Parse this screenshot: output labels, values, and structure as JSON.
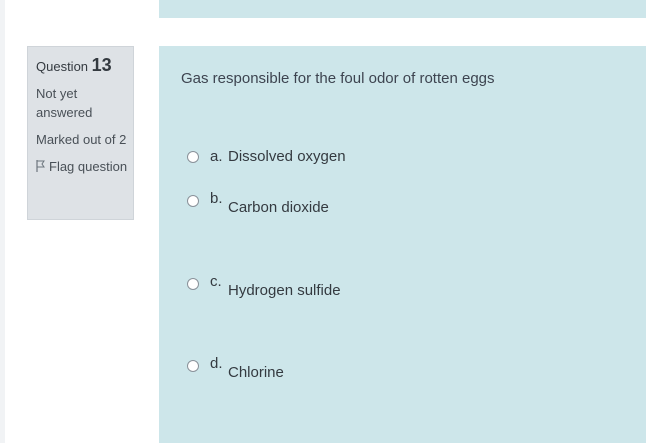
{
  "question_info": {
    "label": "Question",
    "number": "13",
    "state": "Not yet answered",
    "grade": "Marked out of 2",
    "flag_label": "Flag question"
  },
  "question": {
    "text": "Gas responsible for the foul odor of rotten eggs",
    "options": [
      {
        "letter": "a.",
        "text": "Dissolved oxygen",
        "selected": false
      },
      {
        "letter": "b.",
        "text": "Carbon dioxide",
        "selected": false
      },
      {
        "letter": "c.",
        "text": "Hydrogen sulfide",
        "selected": false
      },
      {
        "letter": "d.",
        "text": "Chlorine",
        "selected": false
      }
    ]
  },
  "icons": {
    "flag": "flag-outline-icon",
    "radio": "radio-unchecked-icon"
  },
  "colors": {
    "content_bg": "#cde6ea",
    "info_bg": "#dee2e6"
  }
}
